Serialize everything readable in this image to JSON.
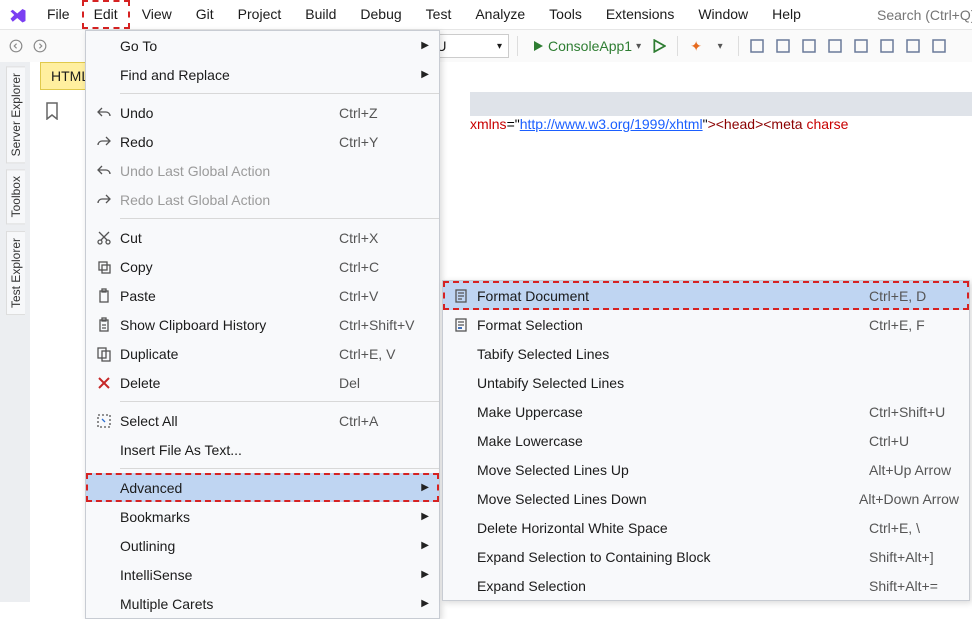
{
  "menubar": {
    "items": [
      "File",
      "Edit",
      "View",
      "Git",
      "Project",
      "Build",
      "Debug",
      "Test",
      "Analyze",
      "Tools",
      "Extensions",
      "Window",
      "Help"
    ],
    "highlighted_index": 1
  },
  "search": {
    "placeholder": "Search (Ctrl+Q)"
  },
  "toolbar": {
    "config_label": "y CPU",
    "run_label": "ConsoleApp1",
    "icon_names": [
      "flame-icon",
      "package-icon",
      "stack-icon",
      "window-icon",
      "align-left-icon",
      "ruler-icon",
      "scissors-icon",
      "grid-icon"
    ]
  },
  "sidebar": {
    "tabs": [
      "Server Explorer",
      "Toolbox",
      "Test Explorer"
    ]
  },
  "doc_tab": "HTML",
  "code": {
    "attr": "xmlns",
    "url": "http://www.w3.org/1999/xhtml",
    "tail_tags": "><head><meta",
    "tail_attr": " charse"
  },
  "edit_menu": {
    "items": [
      {
        "label": "Go To",
        "submenu": true,
        "icon": ""
      },
      {
        "label": "Find and Replace",
        "submenu": true,
        "icon": ""
      },
      {
        "sep": true
      },
      {
        "label": "Undo",
        "shortcut": "Ctrl+Z",
        "icon": "undo-icon"
      },
      {
        "label": "Redo",
        "shortcut": "Ctrl+Y",
        "icon": "redo-icon"
      },
      {
        "label": "Undo Last Global Action",
        "disabled": true,
        "icon": "undo-icon"
      },
      {
        "label": "Redo Last Global Action",
        "disabled": true,
        "icon": "redo-icon"
      },
      {
        "sep": true
      },
      {
        "label": "Cut",
        "shortcut": "Ctrl+X",
        "icon": "cut-icon"
      },
      {
        "label": "Copy",
        "shortcut": "Ctrl+C",
        "icon": "copy-icon"
      },
      {
        "label": "Paste",
        "shortcut": "Ctrl+V",
        "icon": "paste-icon"
      },
      {
        "label": "Show Clipboard History",
        "shortcut": "Ctrl+Shift+V",
        "icon": "clipboard-icon"
      },
      {
        "label": "Duplicate",
        "shortcut": "Ctrl+E, V",
        "icon": "duplicate-icon"
      },
      {
        "label": "Delete",
        "shortcut": "Del",
        "icon": "delete-icon"
      },
      {
        "sep": true
      },
      {
        "label": "Select All",
        "shortcut": "Ctrl+A",
        "icon": "select-all-icon"
      },
      {
        "label": "Insert File As Text...",
        "icon": ""
      },
      {
        "sep": true
      },
      {
        "label": "Advanced",
        "submenu": true,
        "highlighted": true,
        "emph": true,
        "icon": ""
      },
      {
        "label": "Bookmarks",
        "submenu": true,
        "icon": ""
      },
      {
        "label": "Outlining",
        "submenu": true,
        "icon": ""
      },
      {
        "label": "IntelliSense",
        "submenu": true,
        "icon": ""
      },
      {
        "label": "Multiple Carets",
        "submenu": true,
        "icon": ""
      }
    ]
  },
  "advanced_menu": {
    "items": [
      {
        "label": "Format Document",
        "shortcut": "Ctrl+E, D",
        "icon": "doc-icon",
        "highlighted": true,
        "emph": true
      },
      {
        "label": "Format Selection",
        "shortcut": "Ctrl+E, F",
        "icon": "doc-sel-icon"
      },
      {
        "label": "Tabify Selected Lines"
      },
      {
        "label": "Untabify Selected Lines"
      },
      {
        "label": "Make Uppercase",
        "shortcut": "Ctrl+Shift+U"
      },
      {
        "label": "Make Lowercase",
        "shortcut": "Ctrl+U"
      },
      {
        "label": "Move Selected Lines Up",
        "shortcut": "Alt+Up Arrow"
      },
      {
        "label": "Move Selected Lines Down",
        "shortcut": "Alt+Down Arrow"
      },
      {
        "label": "Delete Horizontal White Space",
        "shortcut": "Ctrl+E, \\"
      },
      {
        "label": "Expand Selection to Containing Block",
        "shortcut": "Shift+Alt+]"
      },
      {
        "label": "Expand Selection",
        "shortcut": "Shift+Alt+="
      }
    ]
  }
}
